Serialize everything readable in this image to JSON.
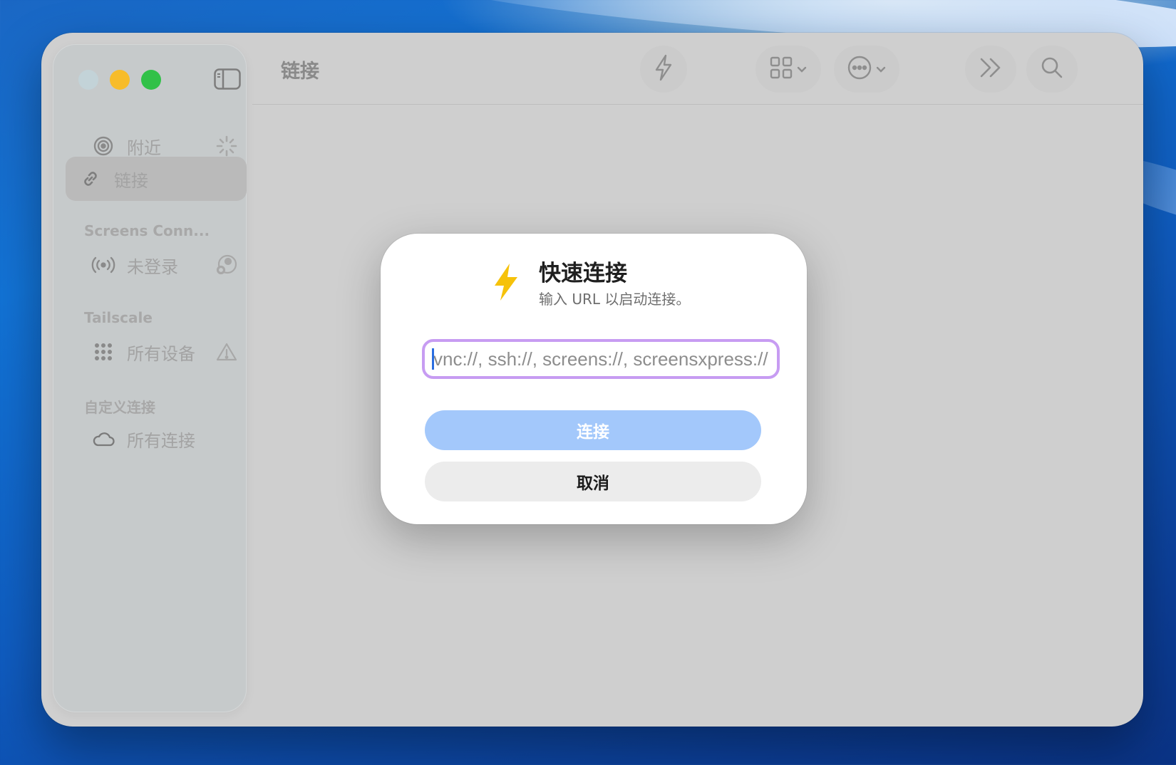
{
  "window": {
    "title": "链接"
  },
  "toolbar": {
    "quick_connect_icon": "bolt-icon",
    "view_icon": "grid-icon",
    "more_icon": "ellipsis-circle-icon",
    "overflow_icon": "double-chevron-right-icon",
    "search_icon": "search-icon"
  },
  "sidebar": {
    "items": [
      {
        "label": "附近",
        "icon": "nearby-radar-icon",
        "trailing_icon": "spinner-icon"
      },
      {
        "label": "链接",
        "icon": "link-icon",
        "selected": true
      }
    ],
    "sections": [
      {
        "header": "Screens Conn...",
        "items": [
          {
            "label": "未登录",
            "icon": "broadcast-icon",
            "trailing_icon": "account-icon"
          }
        ]
      },
      {
        "header": "Tailscale",
        "items": [
          {
            "label": "所有设备",
            "icon": "dots-grid-icon",
            "trailing_icon": "warning-icon"
          }
        ]
      },
      {
        "header": "自定义连接",
        "items": [
          {
            "label": "所有连接",
            "icon": "cloud-icon"
          }
        ]
      }
    ]
  },
  "dialog": {
    "icon": "bolt-icon",
    "title": "快速连接",
    "subtitle": "输入 URL 以启动连接。",
    "url_input": {
      "placeholder": "vnc://, ssh://, screens://, screensxpress://",
      "value": ""
    },
    "connect_label": "连接",
    "cancel_label": "取消"
  },
  "colors": {
    "accent_focus": "#c79cf2",
    "connect_button": "#a3c8fb",
    "bolt": "#f6c20a",
    "traffic_min": "#f7bc2a",
    "traffic_max": "#31c148"
  }
}
